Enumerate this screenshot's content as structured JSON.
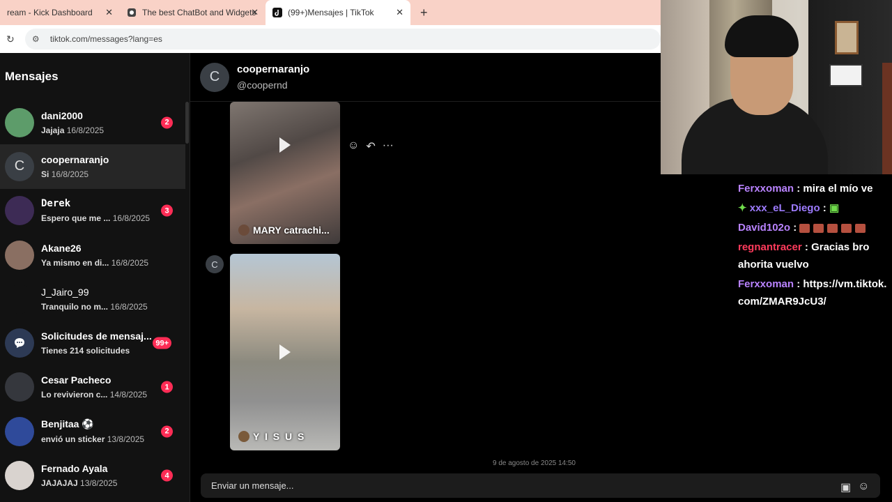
{
  "browser": {
    "tabs": [
      {
        "label": "ream - Kick Dashboard"
      },
      {
        "label": "The best ChatBot and Widgets"
      },
      {
        "label": "(99+)Mensajes | TikTok"
      }
    ],
    "new_tab_icon": "+",
    "url": "tiktok.com/messages?lang=es"
  },
  "sidebar": {
    "title": "Mensajes",
    "conversations": [
      {
        "name": "dani2000",
        "preview": "Jajaja",
        "date": "16/8/2025",
        "badge": "2"
      },
      {
        "name": "coopernaranjo",
        "preview": "Si",
        "date": "16/8/2025",
        "badge": "",
        "initial": "C"
      },
      {
        "name": "Derek",
        "preview": "Espero que me ...",
        "date": "16/8/2025",
        "badge": "3"
      },
      {
        "name": "Akane26",
        "preview": "Ya mismo en di...",
        "date": "16/8/2025",
        "badge": ""
      },
      {
        "name": "J_Jairo_99",
        "preview": "Tranquilo no m...",
        "date": "16/8/2025",
        "badge": ""
      },
      {
        "name": "Solicitudes de mensaj...",
        "preview": "Tienes 214 solicitudes",
        "date": "",
        "badge": "99+"
      },
      {
        "name": "Cesar Pacheco",
        "preview": "Lo revivieron c...",
        "date": "14/8/2025",
        "badge": "1"
      },
      {
        "name": "Benjitaa",
        "preview": "envió un sticker",
        "date": "13/8/2025",
        "badge": "2"
      },
      {
        "name": "Fernado Ayala",
        "preview": "JAJAJAJ",
        "date": "13/8/2025",
        "badge": "4"
      }
    ]
  },
  "chat": {
    "avatar_initial": "C",
    "nickname": "coopernaranjo",
    "handle": "@coopernd",
    "videos": [
      {
        "caption": "MARY catrachi..."
      },
      {
        "caption": "Y I S U S"
      }
    ],
    "date_separator": "9 de agosto de 2025 14:50",
    "composer_placeholder": "Enviar un mensaje..."
  },
  "stream_chat": [
    {
      "user": "Ferxxoman",
      "text": "mira el mío ve",
      "color": "#b983ff"
    },
    {
      "user": "xxx_eL_Diego",
      "text": "",
      "color": "#9d7bff"
    },
    {
      "user": "David102o",
      "text": "",
      "color": "#b983ff"
    },
    {
      "user": "regnantracer",
      "text": "Gracias bro ahorita vuelvo",
      "color": "#ff3b5c"
    },
    {
      "user": "Ferxxoman",
      "text": "https://vm.tiktok.com/ZMAR9JcU3/",
      "color": "#b983ff"
    }
  ]
}
